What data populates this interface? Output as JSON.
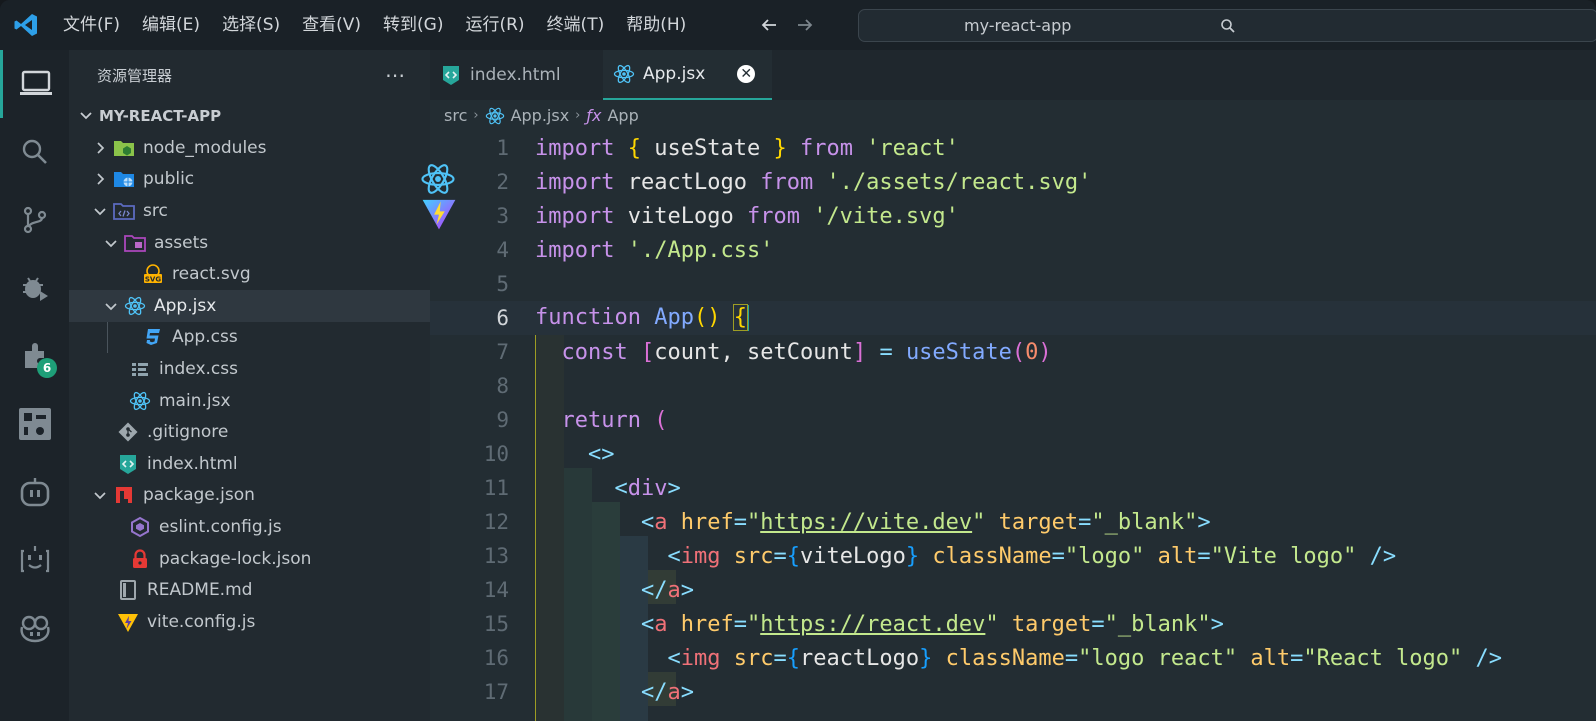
{
  "menu": [
    "文件(F)",
    "编辑(E)",
    "选择(S)",
    "查看(V)",
    "转到(G)",
    "运行(R)",
    "终端(T)",
    "帮助(H)"
  ],
  "search": {
    "text": "my-react-app"
  },
  "activity": {
    "extensions_badge": "6"
  },
  "explorer": {
    "title": "资源管理器",
    "root": "MY-REACT-APP",
    "items": [
      {
        "label": "node_modules",
        "icon": "folder-node-icon"
      },
      {
        "label": "public",
        "icon": "folder-public-icon"
      },
      {
        "label": "src",
        "icon": "folder-src-icon"
      },
      {
        "label": "assets",
        "icon": "folder-assets-icon"
      },
      {
        "label": "react.svg",
        "icon": "svg-file-icon"
      },
      {
        "label": "App.jsx",
        "icon": "react-file-icon"
      },
      {
        "label": "App.css",
        "icon": "css-file-icon"
      },
      {
        "label": "index.css",
        "icon": "css-list-icon"
      },
      {
        "label": "main.jsx",
        "icon": "react-file-icon"
      },
      {
        "label": ".gitignore",
        "icon": "git-file-icon"
      },
      {
        "label": "index.html",
        "icon": "html-file-icon"
      },
      {
        "label": "package.json",
        "icon": "npm-file-icon"
      },
      {
        "label": "eslint.config.js",
        "icon": "eslint-file-icon"
      },
      {
        "label": "package-lock.json",
        "icon": "lock-file-icon"
      },
      {
        "label": "README.md",
        "icon": "readme-file-icon"
      },
      {
        "label": "vite.config.js",
        "icon": "vite-file-icon"
      }
    ]
  },
  "tabs": [
    {
      "label": "index.html",
      "icon": "html-file-icon"
    },
    {
      "label": "App.jsx",
      "icon": "react-file-icon",
      "close": "✕"
    }
  ],
  "breadcrumb": {
    "folder": "src",
    "file": "App.jsx",
    "symbol": "App",
    "symbol_prefix": "ƒx"
  },
  "code": {
    "line_numbers": [
      "1",
      "2",
      "3",
      "4",
      "5",
      "6",
      "7",
      "8",
      "9",
      "10",
      "11",
      "12",
      "13",
      "14",
      "15",
      "16",
      "17"
    ],
    "current_line": "6"
  },
  "colors": {
    "accent": "#26a69a",
    "badge": "#1e9f78",
    "keyword": "#c792ea",
    "string": "#c3e88d"
  }
}
